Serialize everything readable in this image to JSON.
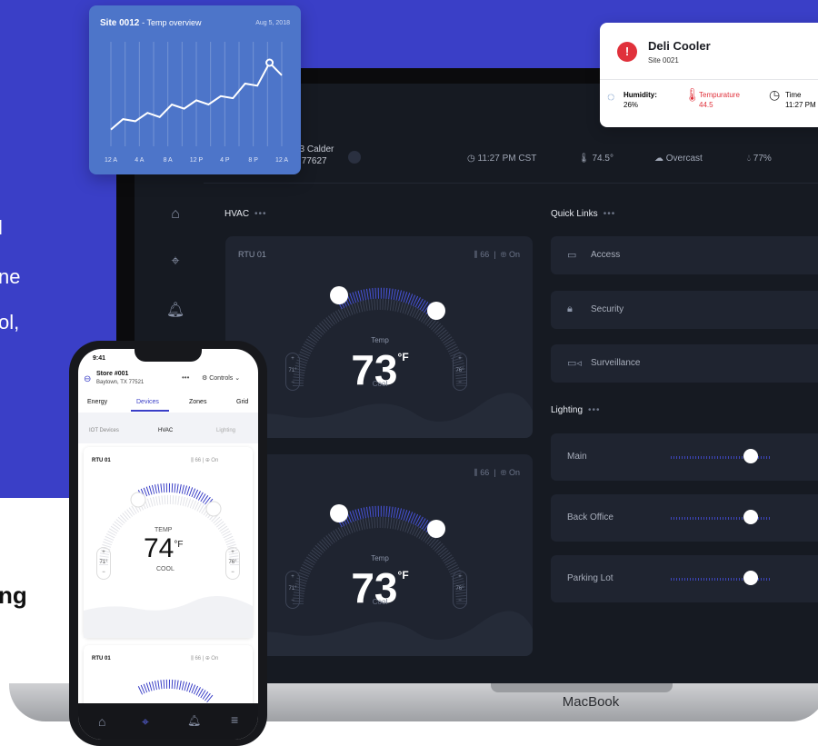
{
  "colors": {
    "brand_blue": "#3a3fc7",
    "accent_indigo": "#3d45b8",
    "chart_blue": "#4d75c9",
    "alert_red": "#e0313b",
    "screen_bg": "#161a22"
  },
  "background_text": {
    "frag1": "l",
    "frag2": "ne",
    "frag3": "ol,",
    "frag4": "ng"
  },
  "overview": {
    "title": "Site 0012",
    "subtitle": "- Temp overview",
    "date": "Aug 5, 2018",
    "ticks": [
      "12 A",
      "4 A",
      "8 A",
      "12 P",
      "4 P",
      "8 P",
      "12 A"
    ]
  },
  "chart_data": {
    "type": "line",
    "title": "Site 0012 - Temp overview",
    "categories": [
      "12 A",
      "4 A",
      "8 A",
      "12 P",
      "4 P",
      "8 P",
      "12 A"
    ],
    "series": [
      {
        "values": [
          58,
          63,
          62,
          66,
          64,
          70,
          68,
          72,
          70,
          74,
          73,
          80,
          79,
          90,
          84
        ]
      }
    ],
    "ylim": [
      50,
      100
    ]
  },
  "alert": {
    "title": "Deli Cooler",
    "site": "Site 0021",
    "humidity_label": "Humidity:",
    "humidity_value": "26%",
    "temp_label": "Tempurature",
    "temp_value": "44.5",
    "time_label": "Time",
    "time_value": "11:27 PM"
  },
  "topbar": {
    "address_line1": "23 Calder",
    "address_line2": "x 77627",
    "time": "11:27 PM CST",
    "temp": "74.5°",
    "weather": "Overcast",
    "humidity": "77%"
  },
  "hvac": {
    "section_title": "HVAC",
    "dots": "•••",
    "units": [
      {
        "name": "RTU 01",
        "setpoint": "66",
        "mode": "On",
        "temp_label": "Temp",
        "temp": "73",
        "unit": "°F",
        "mode_label": "Cool",
        "low": "71°",
        "high": "76°"
      },
      {
        "name": "1",
        "setpoint": "66",
        "mode": "On",
        "temp_label": "Temp",
        "temp": "73",
        "unit": "°F",
        "mode_label": "Cool",
        "low": "71°",
        "high": "76°"
      }
    ]
  },
  "quick_links": {
    "title": "Quick Links",
    "dots": "•••",
    "items": [
      {
        "label": "Access",
        "icon": "card-icon"
      },
      {
        "label": "Security",
        "icon": "lock-icon"
      },
      {
        "label": "Surveillance",
        "icon": "camera-icon"
      }
    ]
  },
  "lighting": {
    "title": "Lighting",
    "dots": "•••",
    "items": [
      {
        "label": "Main",
        "level": 0.8
      },
      {
        "label": "Back Office",
        "level": 0.8
      },
      {
        "label": "Parking Lot",
        "level": 0.8
      }
    ]
  },
  "laptop": {
    "brand": "MacBook"
  },
  "phone": {
    "clock": "9:41",
    "store": "Store #001",
    "location": "Baytown, TX 77521",
    "controls": "Controls",
    "tabs": [
      "Energy",
      "Devices",
      "Zones",
      "Grid"
    ],
    "subtabs": [
      "IOT Devices",
      "HVAC",
      "Lighting"
    ],
    "units": [
      {
        "name": "RTU 01",
        "setpoint": "66",
        "mode": "On",
        "temp_label": "TEMP",
        "temp": "74",
        "unit": "°F",
        "mode_label": "COOL",
        "low": "71°",
        "high": "76°"
      },
      {
        "name": "RTU 01",
        "setpoint": "66",
        "mode": "On"
      }
    ]
  }
}
